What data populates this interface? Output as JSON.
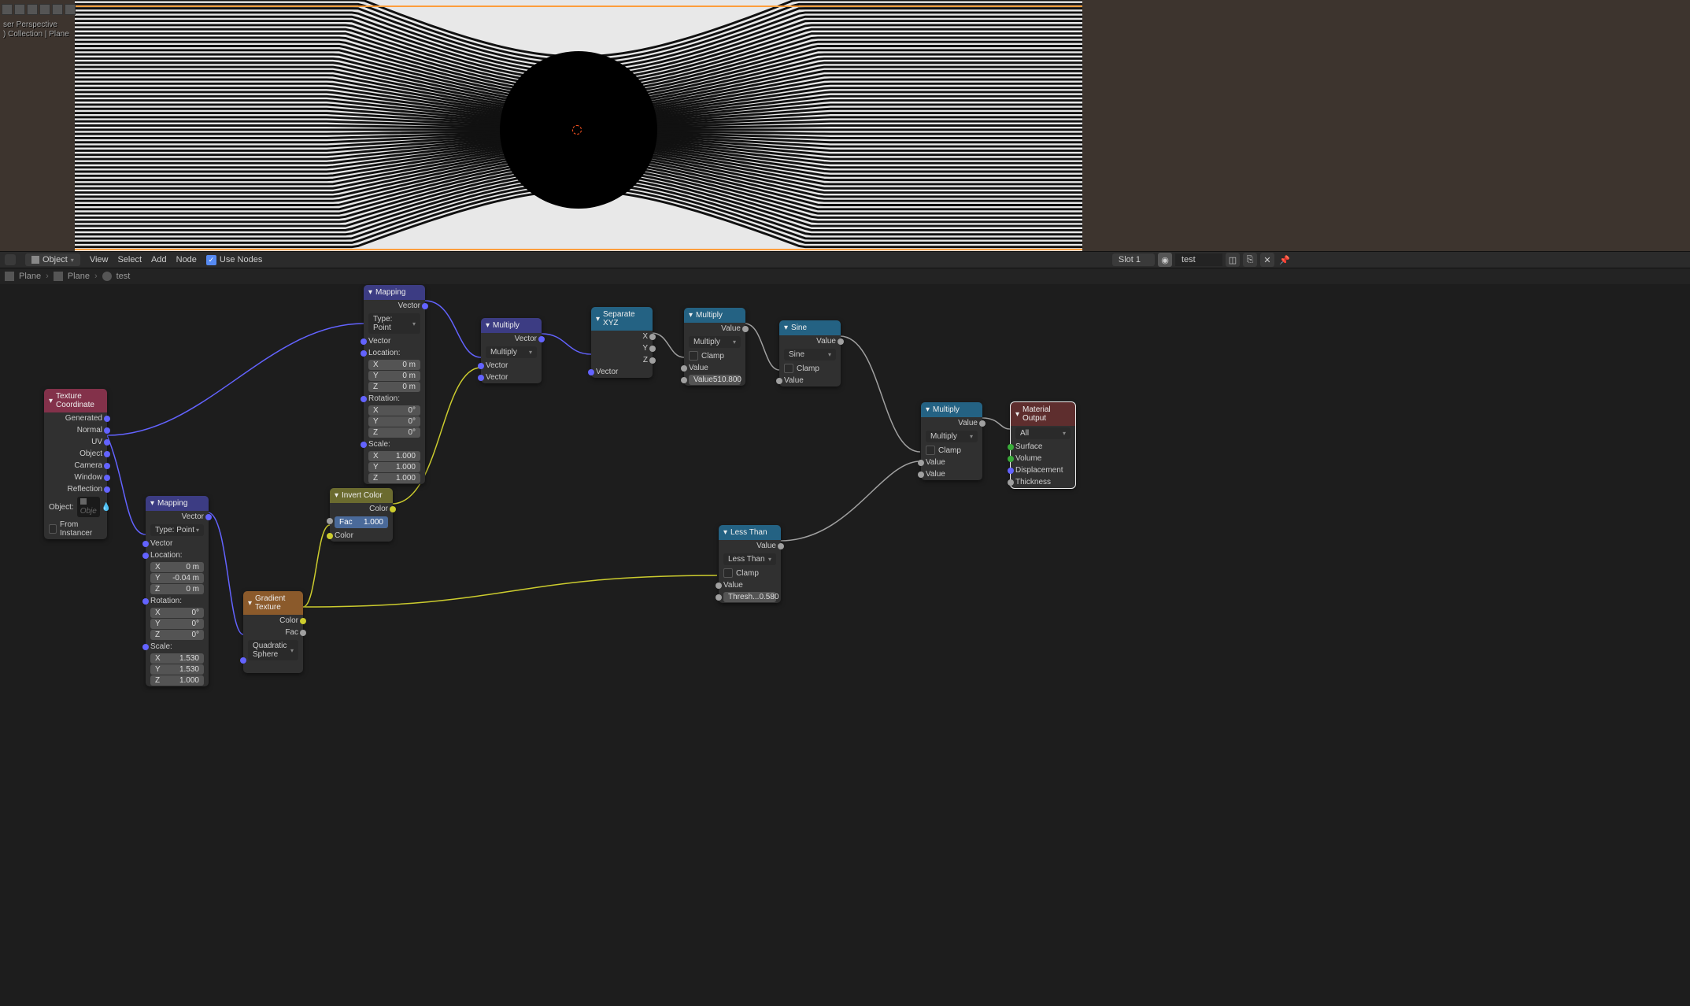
{
  "viewport": {
    "perspective": "ser Perspective",
    "collection": ") Collection | Plane"
  },
  "header": {
    "mode": "Object",
    "view": "View",
    "select": "Select",
    "add": "Add",
    "node": "Node",
    "use_nodes": "Use Nodes",
    "slot": "Slot 1",
    "material": "test"
  },
  "breadcrumb": {
    "a": "Plane",
    "b": "Plane",
    "c": "test"
  },
  "nodes": {
    "texcoord": {
      "title": "Texture Coordinate",
      "outs": [
        "Generated",
        "Normal",
        "UV",
        "Object",
        "Camera",
        "Window",
        "Reflection"
      ],
      "object_label": "Object:",
      "object_field": "Obje",
      "from_instancer": "From Instancer"
    },
    "mapping1": {
      "title": "Mapping",
      "out": "Vector",
      "type_label": "Type:",
      "type": "Point",
      "vector": "Vector",
      "location": "Location:",
      "lx": "X",
      "lxv": "0 m",
      "ly": "Y",
      "lyv": "0 m",
      "lz": "Z",
      "lzv": "0 m",
      "rotation": "Rotation:",
      "rx": "X",
      "rxv": "0°",
      "ry": "Y",
      "ryv": "0°",
      "rz": "Z",
      "rzv": "0°",
      "scale": "Scale:",
      "sx": "X",
      "sxv": "1.000",
      "sy": "Y",
      "syv": "1.000",
      "sz": "Z",
      "szv": "1.000"
    },
    "mapping2": {
      "title": "Mapping",
      "out": "Vector",
      "type_label": "Type:",
      "type": "Point",
      "vector": "Vector",
      "location": "Location:",
      "lx": "X",
      "lxv": "0 m",
      "ly": "Y",
      "lyv": "-0.04 m",
      "lz": "Z",
      "lzv": "0 m",
      "rotation": "Rotation:",
      "rx": "X",
      "rxv": "0°",
      "ry": "Y",
      "ryv": "0°",
      "rz": "Z",
      "rzv": "0°",
      "scale": "Scale:",
      "sx": "X",
      "sxv": "1.530",
      "sy": "Y",
      "syv": "1.530",
      "sz": "Z",
      "szv": "1.000"
    },
    "multiply_vec": {
      "title": "Multiply",
      "out": "Vector",
      "op": "Multiply",
      "v1": "Vector",
      "v2": "Vector"
    },
    "sepxyz": {
      "title": "Separate XYZ",
      "x": "X",
      "y": "Y",
      "z": "Z",
      "vec": "Vector"
    },
    "mult1": {
      "title": "Multiply",
      "out": "Value",
      "op": "Multiply",
      "clamp": "Clamp",
      "value": "Value",
      "value2_label": "Value",
      "value2": "510.800"
    },
    "sine": {
      "title": "Sine",
      "out": "Value",
      "op": "Sine",
      "clamp": "Clamp",
      "value": "Value"
    },
    "mult2": {
      "title": "Multiply",
      "out": "Value",
      "op": "Multiply",
      "clamp": "Clamp",
      "v1": "Value",
      "v2": "Value"
    },
    "invert": {
      "title": "Invert Color",
      "out": "Color",
      "fac_label": "Fac",
      "fac": "1.000",
      "color": "Color"
    },
    "gradient": {
      "title": "Gradient Texture",
      "color": "Color",
      "fac": "Fac",
      "mode": "Quadratic Sphere"
    },
    "lessthan": {
      "title": "Less Than",
      "out": "Value",
      "op": "Less Than",
      "clamp": "Clamp",
      "value": "Value",
      "thresh_label": "Thresh...",
      "thresh": "0.580"
    },
    "matout": {
      "title": "Material Output",
      "target": "All",
      "surface": "Surface",
      "volume": "Volume",
      "displacement": "Displacement",
      "thickness": "Thickness"
    }
  }
}
